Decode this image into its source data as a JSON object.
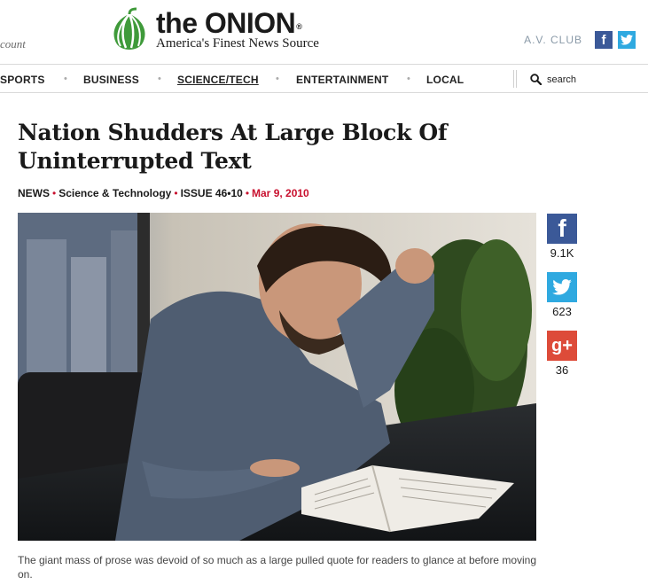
{
  "header": {
    "account_label": "count",
    "logo": {
      "name": "the ONION",
      "registered": "®",
      "tagline": "America's Finest News Source"
    },
    "av_club": "A.V. CLUB"
  },
  "nav": {
    "items": [
      {
        "label": "SPORTS",
        "active": false
      },
      {
        "label": "BUSINESS",
        "active": false
      },
      {
        "label": "SCIENCE/TECH",
        "active": true
      },
      {
        "label": "ENTERTAINMENT",
        "active": false
      },
      {
        "label": "LOCAL",
        "active": false
      }
    ],
    "search_label": "search"
  },
  "article": {
    "headline": "Nation Shudders At Large Block Of Uninterrupted Text",
    "meta": {
      "section": "NEWS",
      "category": "Science & Technology",
      "issue": "ISSUE 46•10",
      "date": "Mar 9, 2010",
      "separator": "•"
    },
    "caption": "The giant mass of prose was devoid of so much as a large pulled quote for readers to glance at before moving on."
  },
  "share": {
    "facebook": "9.1K",
    "twitter": "623",
    "googleplus": "36"
  },
  "colors": {
    "brand_green": "#3f9a3a",
    "meta_red": "#c8102e",
    "facebook": "#3b5998",
    "twitter": "#2fa9e0",
    "googleplus": "#dd4b39"
  }
}
